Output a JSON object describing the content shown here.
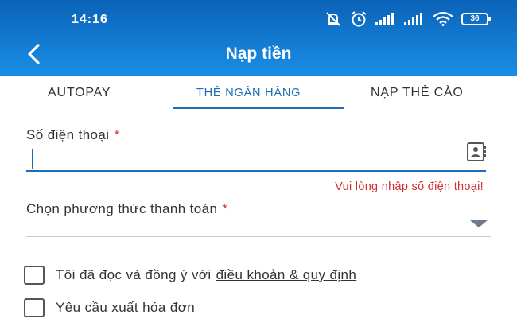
{
  "status_bar": {
    "time": "14:16",
    "battery": "36",
    "icons": [
      "mute-icon",
      "alarm-icon",
      "signal-icon",
      "signal-icon",
      "wifi-icon",
      "battery-icon"
    ]
  },
  "header": {
    "title": "Nạp tiền",
    "back_icon": "chevron-left-icon",
    "background": "#1a8ee5"
  },
  "tabs": [
    {
      "label": "AUTOPAY",
      "active": false
    },
    {
      "label": "THẺ NGÂN HÀNG",
      "active": true
    },
    {
      "label": "NẠP THẺ CÀO",
      "active": false
    }
  ],
  "form": {
    "phone": {
      "label": "Số điện thoại",
      "required_mark": "*",
      "value": "",
      "error": "Vui lòng nhập số điện thoại!",
      "icon": "contact-book-icon"
    },
    "payment_method": {
      "label": "Chọn phương thức thanh toán",
      "required_mark": "*",
      "selected": ""
    },
    "terms": {
      "text": "Tôi đã đọc và đồng ý với",
      "link": "điều khoản & quy định",
      "checked": false
    },
    "invoice": {
      "text": "Yêu cầu xuất hóa đơn",
      "checked": false
    }
  },
  "colors": {
    "accent": "#1b6fb8",
    "error": "#d32f2f"
  }
}
